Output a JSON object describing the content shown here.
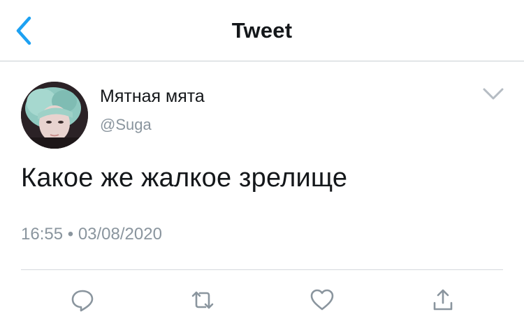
{
  "header": {
    "title": "Tweet"
  },
  "tweet": {
    "display_name": "Мятная мята",
    "handle": "@Suga",
    "text": "Какое же жалкое зрелище",
    "time": "16:55",
    "separator": "•",
    "date": "03/08/2020"
  },
  "colors": {
    "accent": "#1da1f2",
    "muted": "#8a959e",
    "text": "#14171a",
    "divider": "#d5d9dd"
  },
  "icons": {
    "back": "chevron-left-icon",
    "more": "chevron-down-icon",
    "actions": [
      "reply-icon",
      "retweet-icon",
      "like-icon",
      "share-icon"
    ]
  }
}
